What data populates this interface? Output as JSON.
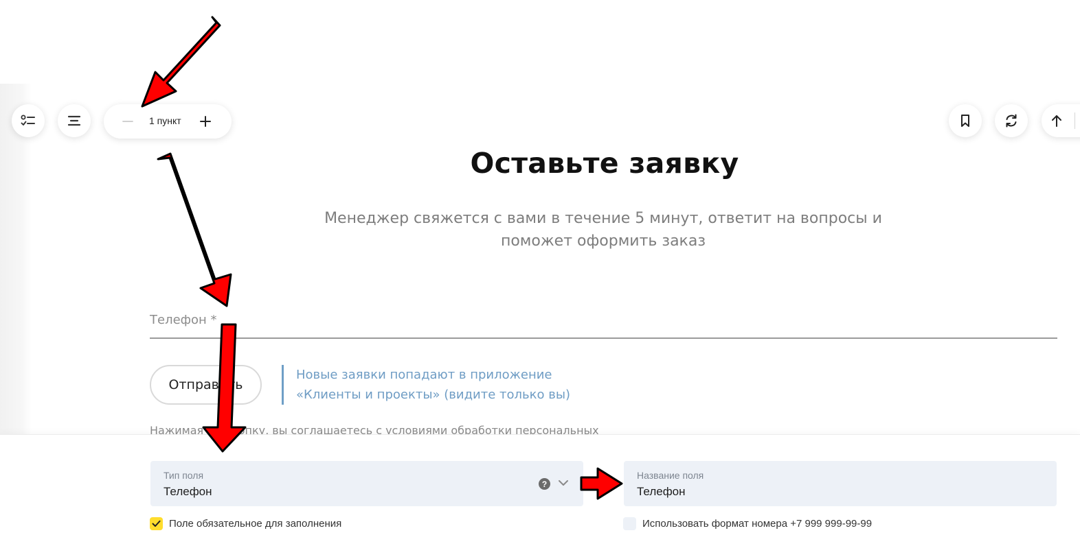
{
  "toolbar": {
    "tasks_icon": "checklist-icon",
    "align_icon": "align-center-icon",
    "stepper": {
      "count_label": "1 пункт",
      "minus_icon": "minus-icon",
      "plus_icon": "plus-icon"
    },
    "bookmark_icon": "bookmark-icon",
    "refresh_icon": "refresh-icon",
    "up_icon": "arrow-up-icon"
  },
  "form": {
    "title": "Оставьте заявку",
    "subtitle_line1": "Менеджер свяжется с вами в течение 5 минут, ответит на вопросы и",
    "subtitle_line2": "поможет оформить заказ",
    "phone_label": "Телефон *",
    "submit_label": "Отправить",
    "note_line1": "Новые заявки попадают в приложение",
    "note_line2": "«Клиенты и проекты» (видите только вы)",
    "consent_text": "Нажимая на кнопку, вы соглашаетесь с условиями обработки персональных"
  },
  "settings": {
    "field_type": {
      "label": "Тип поля",
      "value": "Телефон"
    },
    "field_name": {
      "label": "Название поля",
      "value": "Телефон"
    },
    "required": {
      "label": "Поле обязательное для заполнения",
      "checked": true
    },
    "phone_format": {
      "label": "Использовать формат номера +7 999 999-99-99",
      "checked": false
    }
  },
  "colors": {
    "accent_yellow": "#ffdd2d",
    "note_blue": "#6e9cc4",
    "field_bg": "#edf1f7",
    "annotation_red": "#ff0000"
  }
}
